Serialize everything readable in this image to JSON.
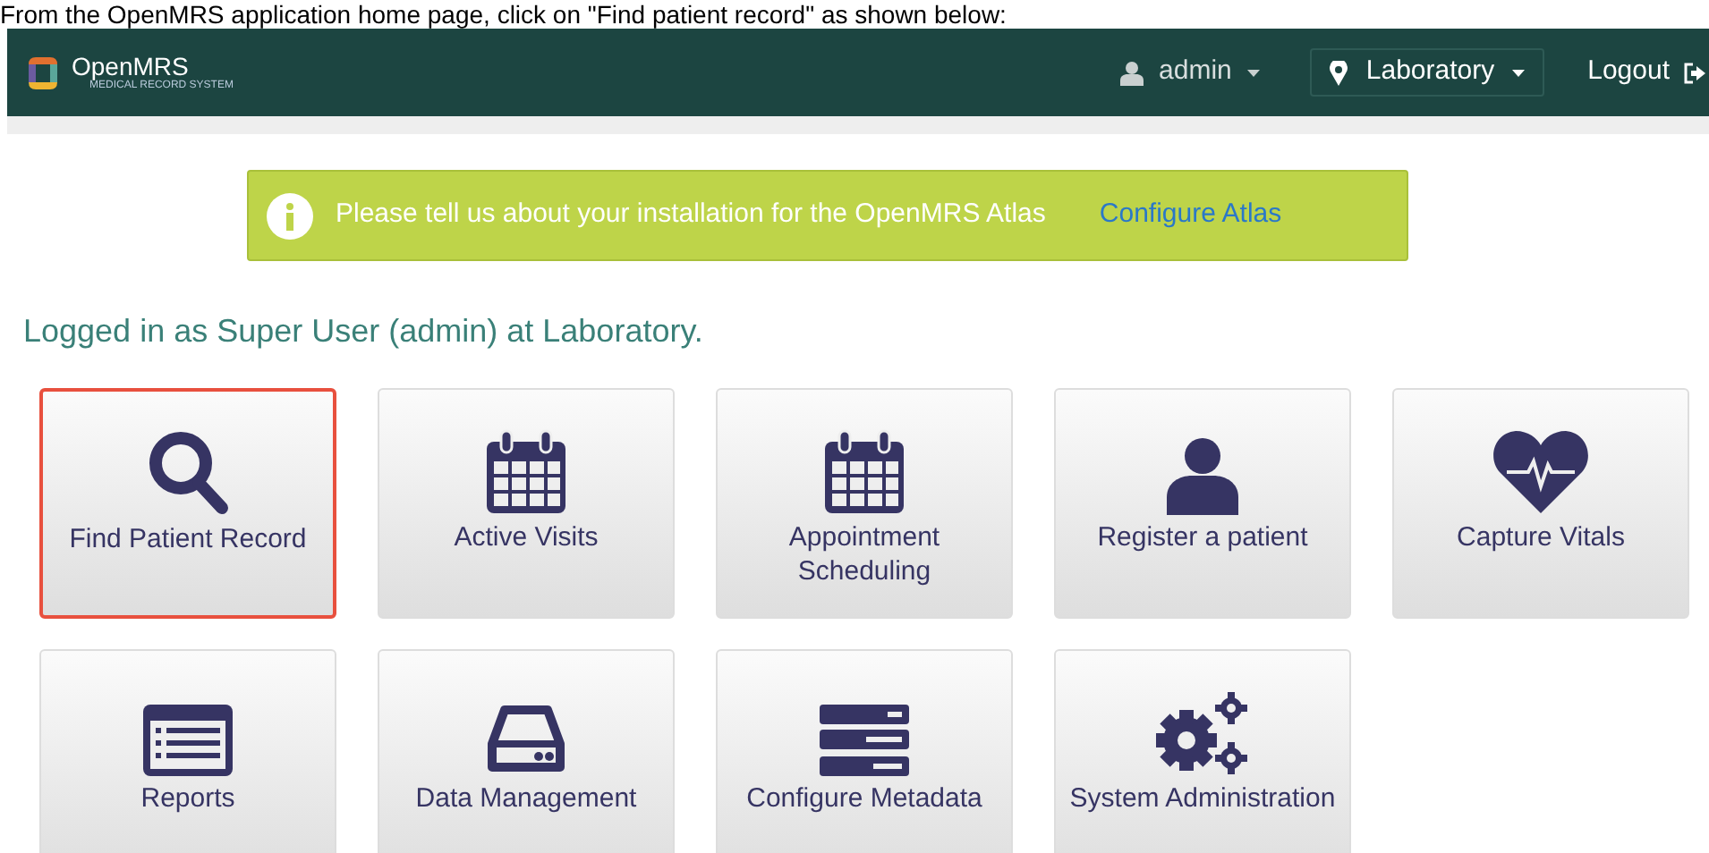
{
  "caption": "From the OpenMRS application home page, click on \"Find patient record\" as shown below:",
  "header": {
    "logo_text": "OpenMRS",
    "logo_subtitle": "MEDICAL RECORD SYSTEM",
    "user": "admin",
    "location": "Laboratory",
    "logout": "Logout"
  },
  "banner": {
    "message": "Please tell us about your installation for the OpenMRS Atlas",
    "link": "Configure Atlas"
  },
  "logged_in": "Logged in as Super User (admin) at Laboratory.",
  "apps": [
    {
      "label": "Find Patient Record",
      "kind": "search",
      "highlighted": true
    },
    {
      "label": "Active Visits",
      "kind": "calendar",
      "highlighted": false
    },
    {
      "label": "Appointment Scheduling",
      "kind": "calendar",
      "highlighted": false
    },
    {
      "label": "Register a patient",
      "kind": "user",
      "highlighted": false
    },
    {
      "label": "Capture Vitals",
      "kind": "heart",
      "highlighted": false
    },
    {
      "label": "Reports",
      "kind": "list",
      "highlighted": false
    },
    {
      "label": "Data Management",
      "kind": "drive",
      "highlighted": false
    },
    {
      "label": "Configure Metadata",
      "kind": "server",
      "highlighted": false
    },
    {
      "label": "System Administration",
      "kind": "gears",
      "highlighted": false
    }
  ]
}
